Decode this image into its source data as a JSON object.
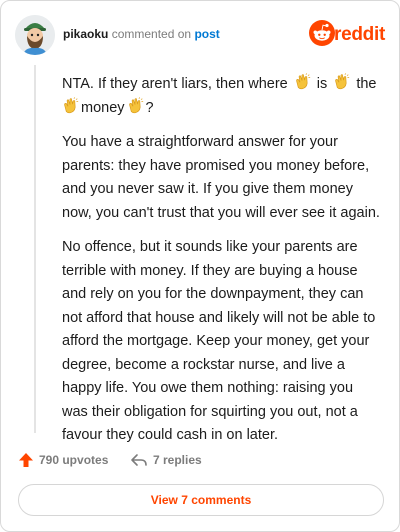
{
  "header": {
    "username": "pikaoku",
    "action_text": "commented on",
    "post_link": "post",
    "brand": "reddit"
  },
  "comment": {
    "line1_a": "NTA. If they aren't liars, then where",
    "line1_b": "is",
    "line1_c": "the",
    "line2_word": "money",
    "line2_end": "?",
    "paragraph2": "You have a straightforward answer for your parents: they have promised you money before, and you never saw it. If you give them money now, you can't trust that you will ever see it again.",
    "paragraph3": "No offence, but it sounds like your parents are terrible with money. If they are buying a house and rely on you for the downpayment, they can not afford that house and likely will not be able to afford the mortgage. Keep your money, get your degree, become a rockstar nurse, and live a happy life. You owe them nothing: raising you was their obligation for squirting you out, not a favour they could cash in on later."
  },
  "footer": {
    "upvotes": "790 upvotes",
    "replies": "7 replies",
    "view_comments": "View 7 comments"
  },
  "colors": {
    "brand": "#ff4500",
    "link": "#0079d3",
    "muted": "#7c7c7c"
  },
  "icons": [
    "user-avatar",
    "reddit-snoo-icon",
    "clap-emoji",
    "upvote-arrow-icon",
    "reply-arrow-icon"
  ]
}
